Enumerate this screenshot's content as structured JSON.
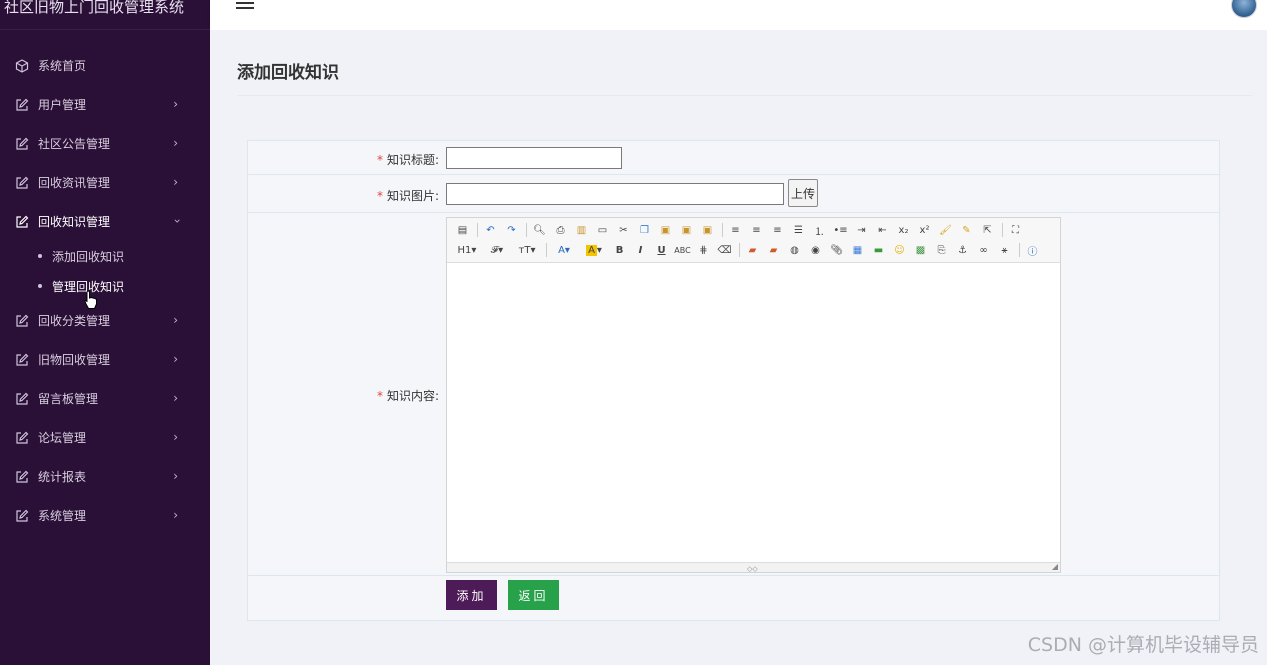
{
  "app": {
    "title": "社区旧物上门回收管理系统"
  },
  "sidebar": {
    "items": [
      {
        "label": "系统首页",
        "icon": "cube-icon",
        "has_arrow": false
      },
      {
        "label": "用户管理",
        "icon": "edit-icon",
        "has_arrow": true
      },
      {
        "label": "社区公告管理",
        "icon": "edit-icon",
        "has_arrow": true
      },
      {
        "label": "回收资讯管理",
        "icon": "edit-icon",
        "has_arrow": true
      },
      {
        "label": "回收知识管理",
        "icon": "edit-icon",
        "has_arrow": true,
        "expanded": true,
        "children": [
          {
            "label": "添加回收知识"
          },
          {
            "label": "管理回收知识"
          }
        ]
      },
      {
        "label": "回收分类管理",
        "icon": "edit-icon",
        "has_arrow": true
      },
      {
        "label": "旧物回收管理",
        "icon": "edit-icon",
        "has_arrow": true
      },
      {
        "label": "留言板管理",
        "icon": "edit-icon",
        "has_arrow": true
      },
      {
        "label": "论坛管理",
        "icon": "edit-icon",
        "has_arrow": true
      },
      {
        "label": "统计报表",
        "icon": "edit-icon",
        "has_arrow": true
      },
      {
        "label": "系统管理",
        "icon": "edit-icon",
        "has_arrow": true
      }
    ]
  },
  "header": {
    "menu_icon": "hamburger-icon",
    "avatar_icon": "avatar-icon"
  },
  "main": {
    "title": "添加回收知识",
    "form": {
      "required_mark": "*",
      "title_label": "知识标题:",
      "title_value": "",
      "image_label": "知识图片:",
      "image_value": "",
      "upload_label": "上传",
      "content_label": "知识内容:",
      "toolbar_row1": [
        "source",
        "undo",
        "redo",
        "preview",
        "print",
        "template",
        "code",
        "cut",
        "copy",
        "paste",
        "pasteplain",
        "pasteword",
        "align-left",
        "align-center",
        "align-right",
        "justify",
        "ordered-list",
        "unordered-list",
        "indent",
        "outdent",
        "subscript",
        "superscript",
        "format-brush",
        "clear",
        "select-all",
        "fullscreen"
      ],
      "toolbar_row2_text": [
        "H1",
        "𝓕",
        "тT"
      ],
      "submit_label": "添加",
      "back_label": "返回"
    }
  },
  "watermark": "CSDN @计算机毕设辅导员",
  "colors": {
    "sidebar_bg": "#2a0f36",
    "add_button": "#4d1b57",
    "back_button": "#27a24a",
    "required": "#e0463c"
  }
}
